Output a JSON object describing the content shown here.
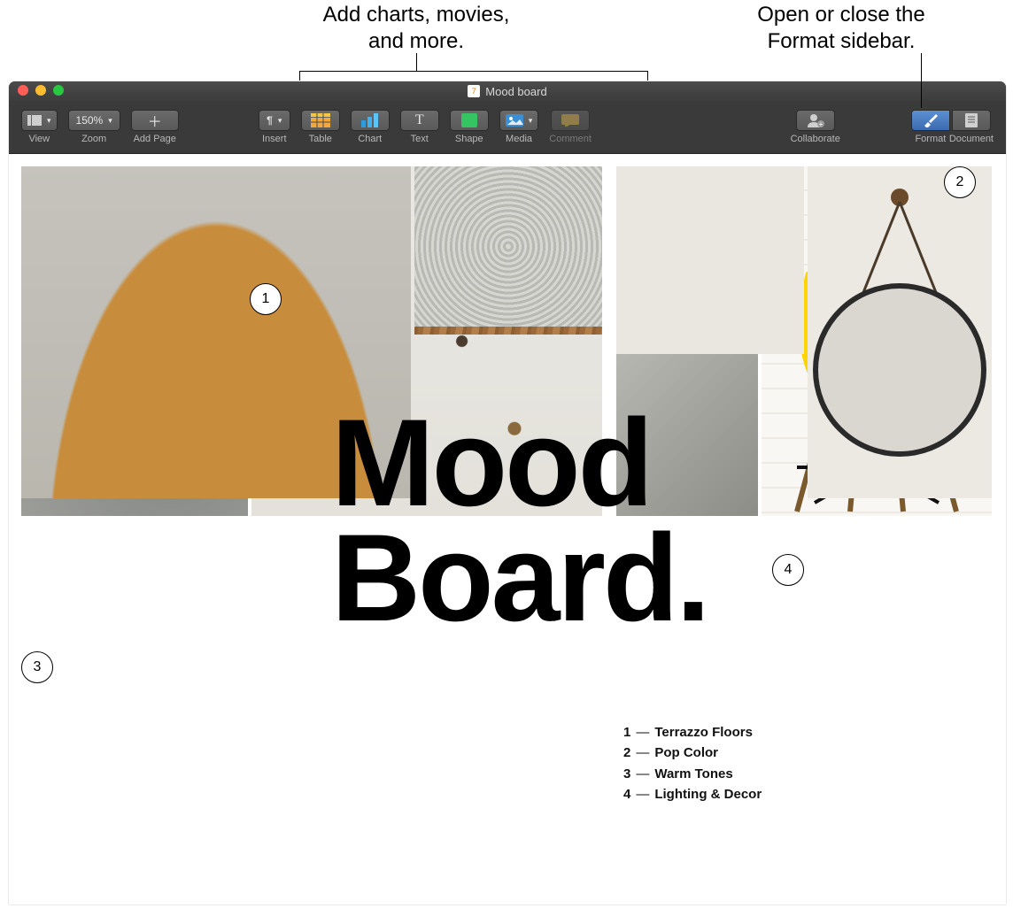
{
  "annotations": {
    "left": "Add charts, movies,\nand more.",
    "right": "Open or close the\nFormat sidebar."
  },
  "window": {
    "title": "Mood board"
  },
  "toolbar": {
    "view": "View",
    "zoom_label": "Zoom",
    "zoom_value": "150%",
    "add_page": "Add Page",
    "insert": "Insert",
    "table": "Table",
    "chart": "Chart",
    "text": "Text",
    "shape": "Shape",
    "media": "Media",
    "comment": "Comment",
    "collaborate": "Collaborate",
    "format": "Format",
    "document": "Document"
  },
  "doc": {
    "title": "Mood\nBoard.",
    "bubbles": {
      "b1": "1",
      "b2": "2",
      "b3": "3",
      "b4": "4"
    },
    "legend": [
      {
        "n": "1",
        "t": "Terrazzo Floors"
      },
      {
        "n": "2",
        "t": "Pop Color"
      },
      {
        "n": "3",
        "t": "Warm Tones"
      },
      {
        "n": "4",
        "t": "Lighting & Decor"
      }
    ]
  }
}
